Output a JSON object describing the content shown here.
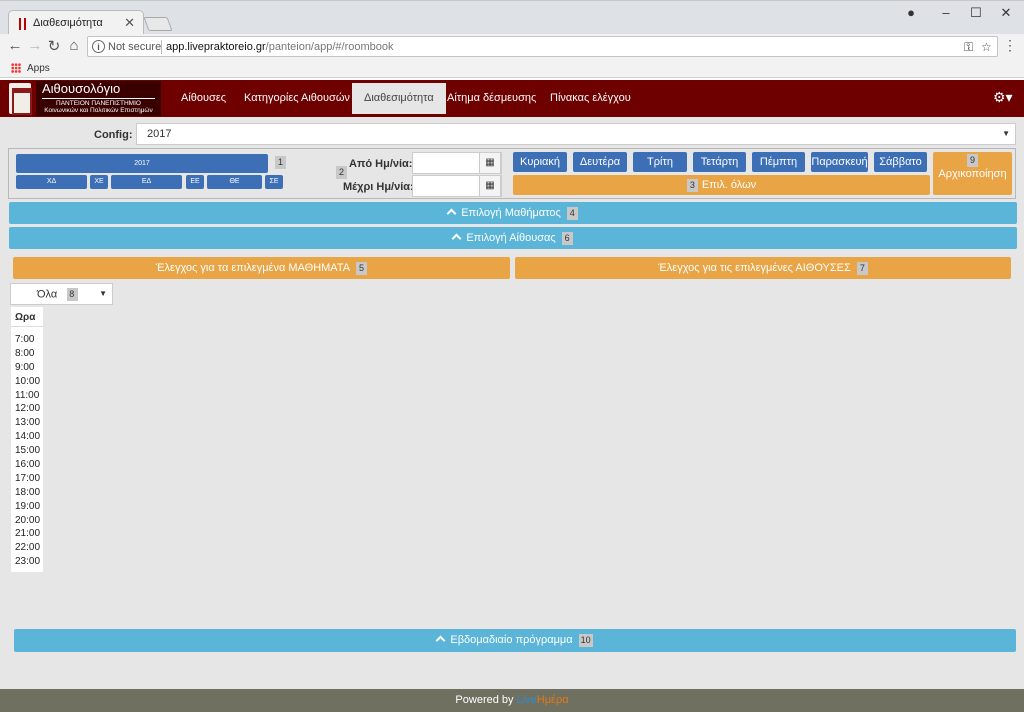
{
  "browser": {
    "tab_title": "Διαθεσιμότητα",
    "tab_close": "✕",
    "not_secure": "Not secure",
    "url_host": "app.livepraktoreio.gr",
    "url_path": "/panteion/app/#/roombook",
    "bookmarks_apps": "Apps"
  },
  "navbar": {
    "brand_title": "Αιθουσολόγιο",
    "brand_sub1": "ΠΑΝΤΕΙΟΝ ΠΑΝΕΠΙΣΤΗΜΙΟ",
    "brand_sub2": "Κοινωνικών και Πολιτικών Επιστημών",
    "items": [
      "Αίθουσες",
      "Κατηγορίες Αιθουσών",
      "Διαθεσιμότητα",
      "Αίτημα δέσμευσης",
      "Πίνακας ελέγχου"
    ],
    "active_index": 2
  },
  "config": {
    "label": "Config:",
    "value": "2017"
  },
  "period": {
    "year_bar": "2017",
    "segments": [
      "ΧΔ",
      "ΧΕ",
      "ΕΔ",
      "ΕΕ",
      "ΘΕ",
      "ΣΕ"
    ],
    "badge1": "1",
    "badge2": "2",
    "from_label": "Από Ημ/νία:",
    "to_label": "Μέχρι Ημ/νία:",
    "days": [
      "Κυριακή",
      "Δευτέρα",
      "Τρίτη",
      "Τετάρτη",
      "Πέμπτη",
      "Παρασκευή",
      "Σάββατο"
    ],
    "select_all_badge": "3",
    "select_all": "Επιλ. όλων",
    "reset_badge": "9",
    "reset": "Αρχικοποίηση"
  },
  "accordions": {
    "courses": "Επιλογή Μαθήματος",
    "courses_badge": "4",
    "rooms": "Επιλογή Αίθουσας",
    "rooms_badge": "6",
    "weekly": "Εβδομαδιαίο πρόγραμμα",
    "weekly_badge": "10"
  },
  "checks": {
    "courses": "Έλεγχος για τα επιλεγμένα ΜΑΘΗΜΑΤΑ",
    "courses_badge": "5",
    "rooms": "Έλεγχος για τις επιλεγμένες ΑΙΘΟΥΣΕΣ",
    "rooms_badge": "7"
  },
  "filter": {
    "value": "Όλα",
    "badge": "8"
  },
  "schedule": {
    "header": "Ωρα",
    "hours": [
      "7:00",
      "8:00",
      "9:00",
      "10:00",
      "11:00",
      "12:00",
      "13:00",
      "14:00",
      "15:00",
      "16:00",
      "17:00",
      "18:00",
      "19:00",
      "20:00",
      "21:00",
      "22:00",
      "23:00"
    ]
  },
  "footer": {
    "text": "Powered by",
    "part1": "Live",
    "part2": "Ημέρα"
  },
  "colors": {
    "navbar": "#6e0000",
    "primary_blue": "#3c6fb6",
    "accordion_blue": "#5ab5d9",
    "orange": "#e8a445",
    "footer": "#707060"
  }
}
